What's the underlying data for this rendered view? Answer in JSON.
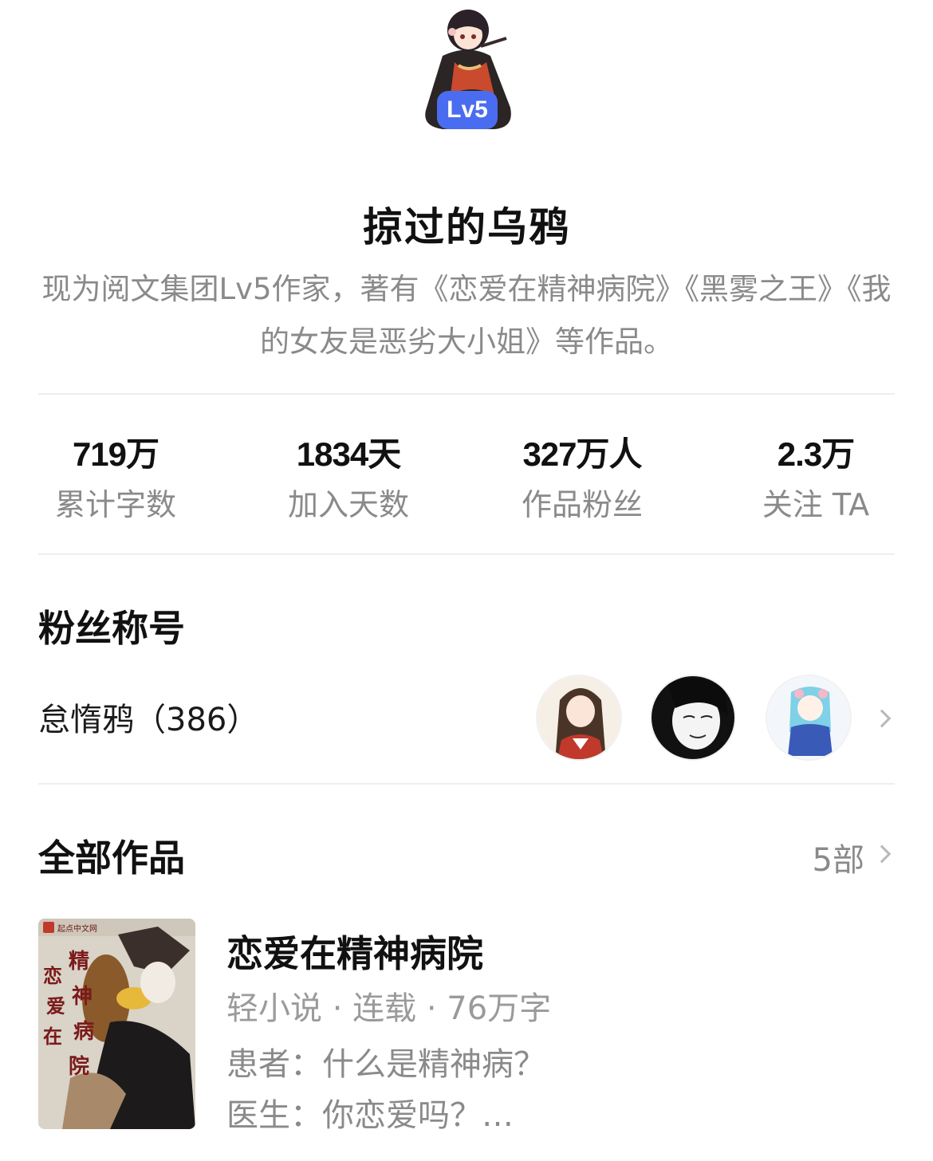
{
  "profile": {
    "level_badge": "Lv5",
    "name": "掠过的乌鸦",
    "bio": "现为阅文集团Lv5作家，著有《恋爱在精神病院》《黑雾之王》《我的女友是恶劣大小姐》等作品。"
  },
  "stats": [
    {
      "value": "719万",
      "label": "累计字数"
    },
    {
      "value": "1834天",
      "label": "加入天数"
    },
    {
      "value": "327万人",
      "label": "作品粉丝"
    },
    {
      "value": "2.3万",
      "label": "关注 TA"
    }
  ],
  "fan_section": {
    "title": "粉丝称号",
    "fan_title": "怠惰鸦（386）"
  },
  "works_section": {
    "title": "全部作品",
    "count": "5部"
  },
  "book": {
    "cover_site": "起点中文网",
    "cover_title_chars": [
      "恋",
      "爱",
      "在",
      "精",
      "神",
      "病",
      "院"
    ],
    "title": "恋爱在精神病院",
    "meta": "轻小说 · 连载 · 76万字",
    "desc_line1": "患者：什么是精神病？",
    "desc_line2": "医生：你恋爱吗？…"
  },
  "colors": {
    "badge": "#4a6cf0",
    "muted_text": "#8a8a8a",
    "divider": "#eeeeee"
  }
}
